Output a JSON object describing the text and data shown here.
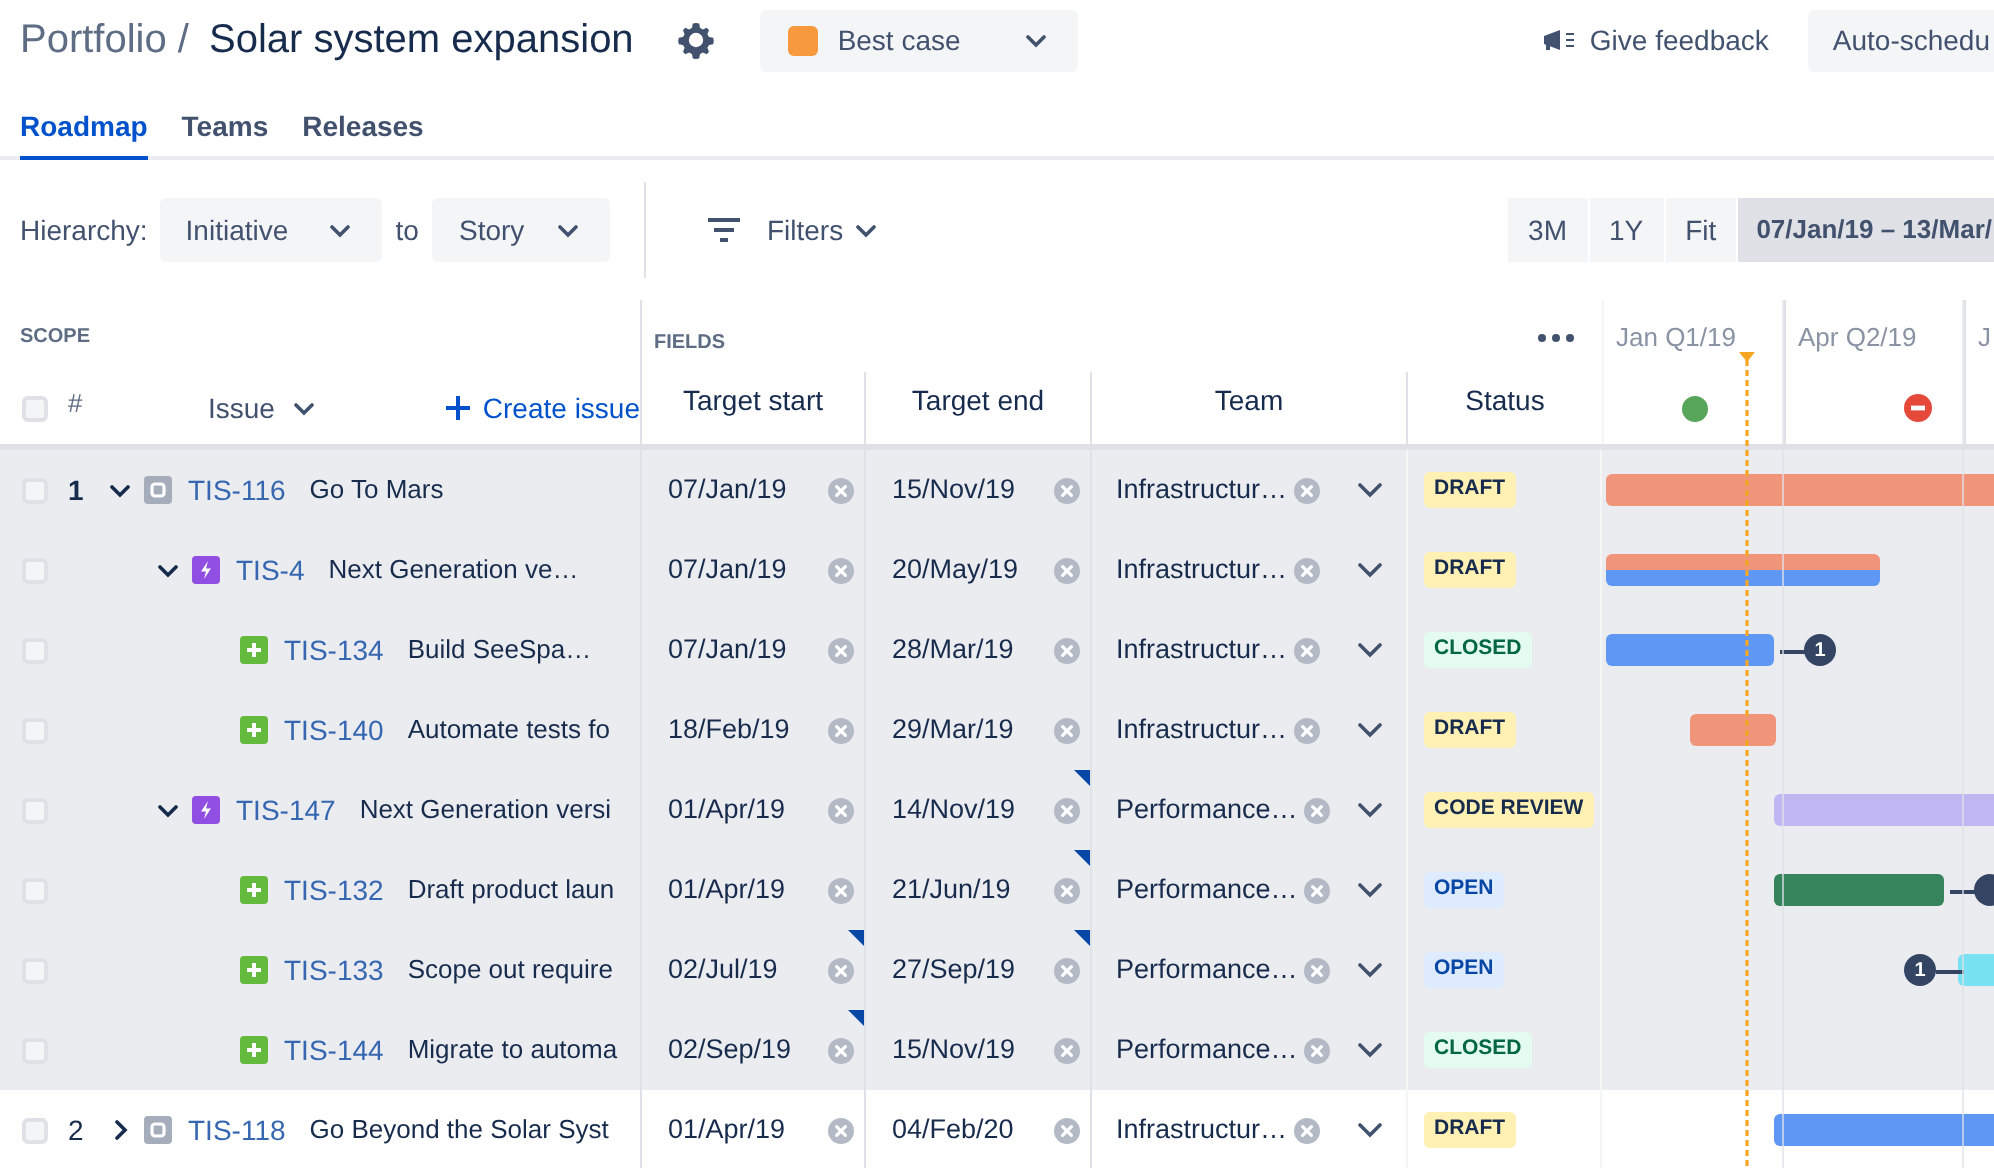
{
  "header": {
    "breadcrumb": "Portfolio /",
    "title": "Solar system expansion",
    "scenario": {
      "label": "Best case",
      "color": "#f79a3e"
    },
    "feedback": "Give feedback",
    "auto_schedule": "Auto-schedu"
  },
  "tabs": [
    {
      "label": "Roadmap",
      "selected": true
    },
    {
      "label": "Teams",
      "selected": false
    },
    {
      "label": "Releases",
      "selected": false
    }
  ],
  "toolbar": {
    "hierarchy_label": "Hierarchy:",
    "from": "Initiative",
    "to_label": "to",
    "to": "Story",
    "filters": "Filters",
    "zoom_options": [
      "3M",
      "1Y",
      "Fit"
    ],
    "date_range": "07/Jan/19 – 13/Mar/"
  },
  "table": {
    "scope_label": "SCOPE",
    "fields_label": "FIELDS",
    "number_header": "#",
    "issue_header": "Issue",
    "create_issue": "Create issue",
    "columns": [
      "Target start",
      "Target end",
      "Team",
      "Status"
    ],
    "select_all_checked": false,
    "quarters": [
      {
        "label": "Jan Q1/19",
        "kind": "ok"
      },
      {
        "label": "Apr Q2/19",
        "kind": "blocked"
      },
      {
        "label": "J"
      }
    ],
    "rows": [
      {
        "number": "1",
        "kind": "initiative",
        "key": "TIS-116",
        "summary": "Go To Mars",
        "expanded": true,
        "checked": false,
        "highlighted": true,
        "start": "07/Jan/19",
        "end": "15/Nov/19",
        "start_flagged": false,
        "end_flagged": false,
        "team": "Infrastructur…",
        "status": {
          "label": "DRAFT",
          "kind": "draft"
        },
        "color": "#f0957a",
        "children": [
          {
            "kind": "epic",
            "key": "TIS-4",
            "summary": "Next Generation ve…",
            "expanded": true,
            "checked": false,
            "start": "07/Jan/19",
            "end": "20/May/19",
            "start_flagged": false,
            "end_flagged": false,
            "team": "Infrastructur…",
            "status": {
              "label": "DRAFT",
              "kind": "draft"
            },
            "segments": [
              {
                "color": "#f0957a"
              },
              {
                "color": "#5f97f5"
              }
            ],
            "children": [
              {
                "kind": "story",
                "key": "TIS-134",
                "summary": "Build SeeSpa…",
                "checked": false,
                "start": "07/Jan/19",
                "end": "28/Mar/19",
                "start_flagged": false,
                "end_flagged": false,
                "team": "Infrastructur…",
                "status": {
                  "label": "CLOSED",
                  "kind": "done"
                },
                "color": "#5f97f5",
                "dependency": {
                  "kind": "outgoing",
                  "count": "1"
                }
              },
              {
                "kind": "story",
                "key": "TIS-140",
                "summary": "Automate tests fo",
                "checked": false,
                "start": "18/Feb/19",
                "end": "29/Mar/19",
                "start_flagged": false,
                "end_flagged": false,
                "team": "Infrastructur…",
                "status": {
                  "label": "DRAFT",
                  "kind": "draft"
                },
                "color": "#f0957a"
              }
            ]
          },
          {
            "kind": "epic",
            "key": "TIS-147",
            "summary": "Next Generation versi",
            "expanded": true,
            "checked": false,
            "start": "01/Apr/19",
            "end": "14/Nov/19",
            "start_flagged": false,
            "end_flagged": true,
            "team": "Performance…",
            "status": {
              "label": "CODE REVIEW",
              "kind": "draft"
            },
            "color": "#c0b6f2",
            "children": [
              {
                "kind": "story",
                "key": "TIS-132",
                "summary": "Draft product laun",
                "checked": false,
                "start": "01/Apr/19",
                "end": "21/Jun/19",
                "start_flagged": false,
                "end_flagged": true,
                "team": "Performance…",
                "status": {
                  "label": "OPEN",
                  "kind": "open"
                },
                "color": "#36845c",
                "dependency": {
                  "kind": "outgoing"
                }
              },
              {
                "kind": "story",
                "key": "TIS-133",
                "summary": "Scope out require",
                "checked": false,
                "start": "02/Jul/19",
                "end": "27/Sep/19",
                "start_flagged": true,
                "end_flagged": true,
                "team": "Performance…",
                "status": {
                  "label": "OPEN",
                  "kind": "open"
                },
                "color": "#79e2f2",
                "dependency": {
                  "kind": "incoming",
                  "count": "1"
                }
              },
              {
                "kind": "story",
                "key": "TIS-144",
                "summary": "Migrate to automa",
                "checked": false,
                "start": "02/Sep/19",
                "end": "15/Nov/19",
                "start_flagged": true,
                "end_flagged": false,
                "team": "Performance…",
                "status": {
                  "label": "CLOSED",
                  "kind": "done"
                }
              }
            ]
          }
        ]
      },
      {
        "number": "2",
        "kind": "initiative",
        "key": "TIS-118",
        "summary": "Go Beyond the Solar Syst",
        "expanded": false,
        "checked": false,
        "highlighted": false,
        "start": "01/Apr/19",
        "end": "04/Feb/20",
        "start_flagged": false,
        "end_flagged": false,
        "team": "Infrastructur…",
        "status": {
          "label": "DRAFT",
          "kind": "draft"
        },
        "color": "#5f97f5"
      }
    ]
  }
}
